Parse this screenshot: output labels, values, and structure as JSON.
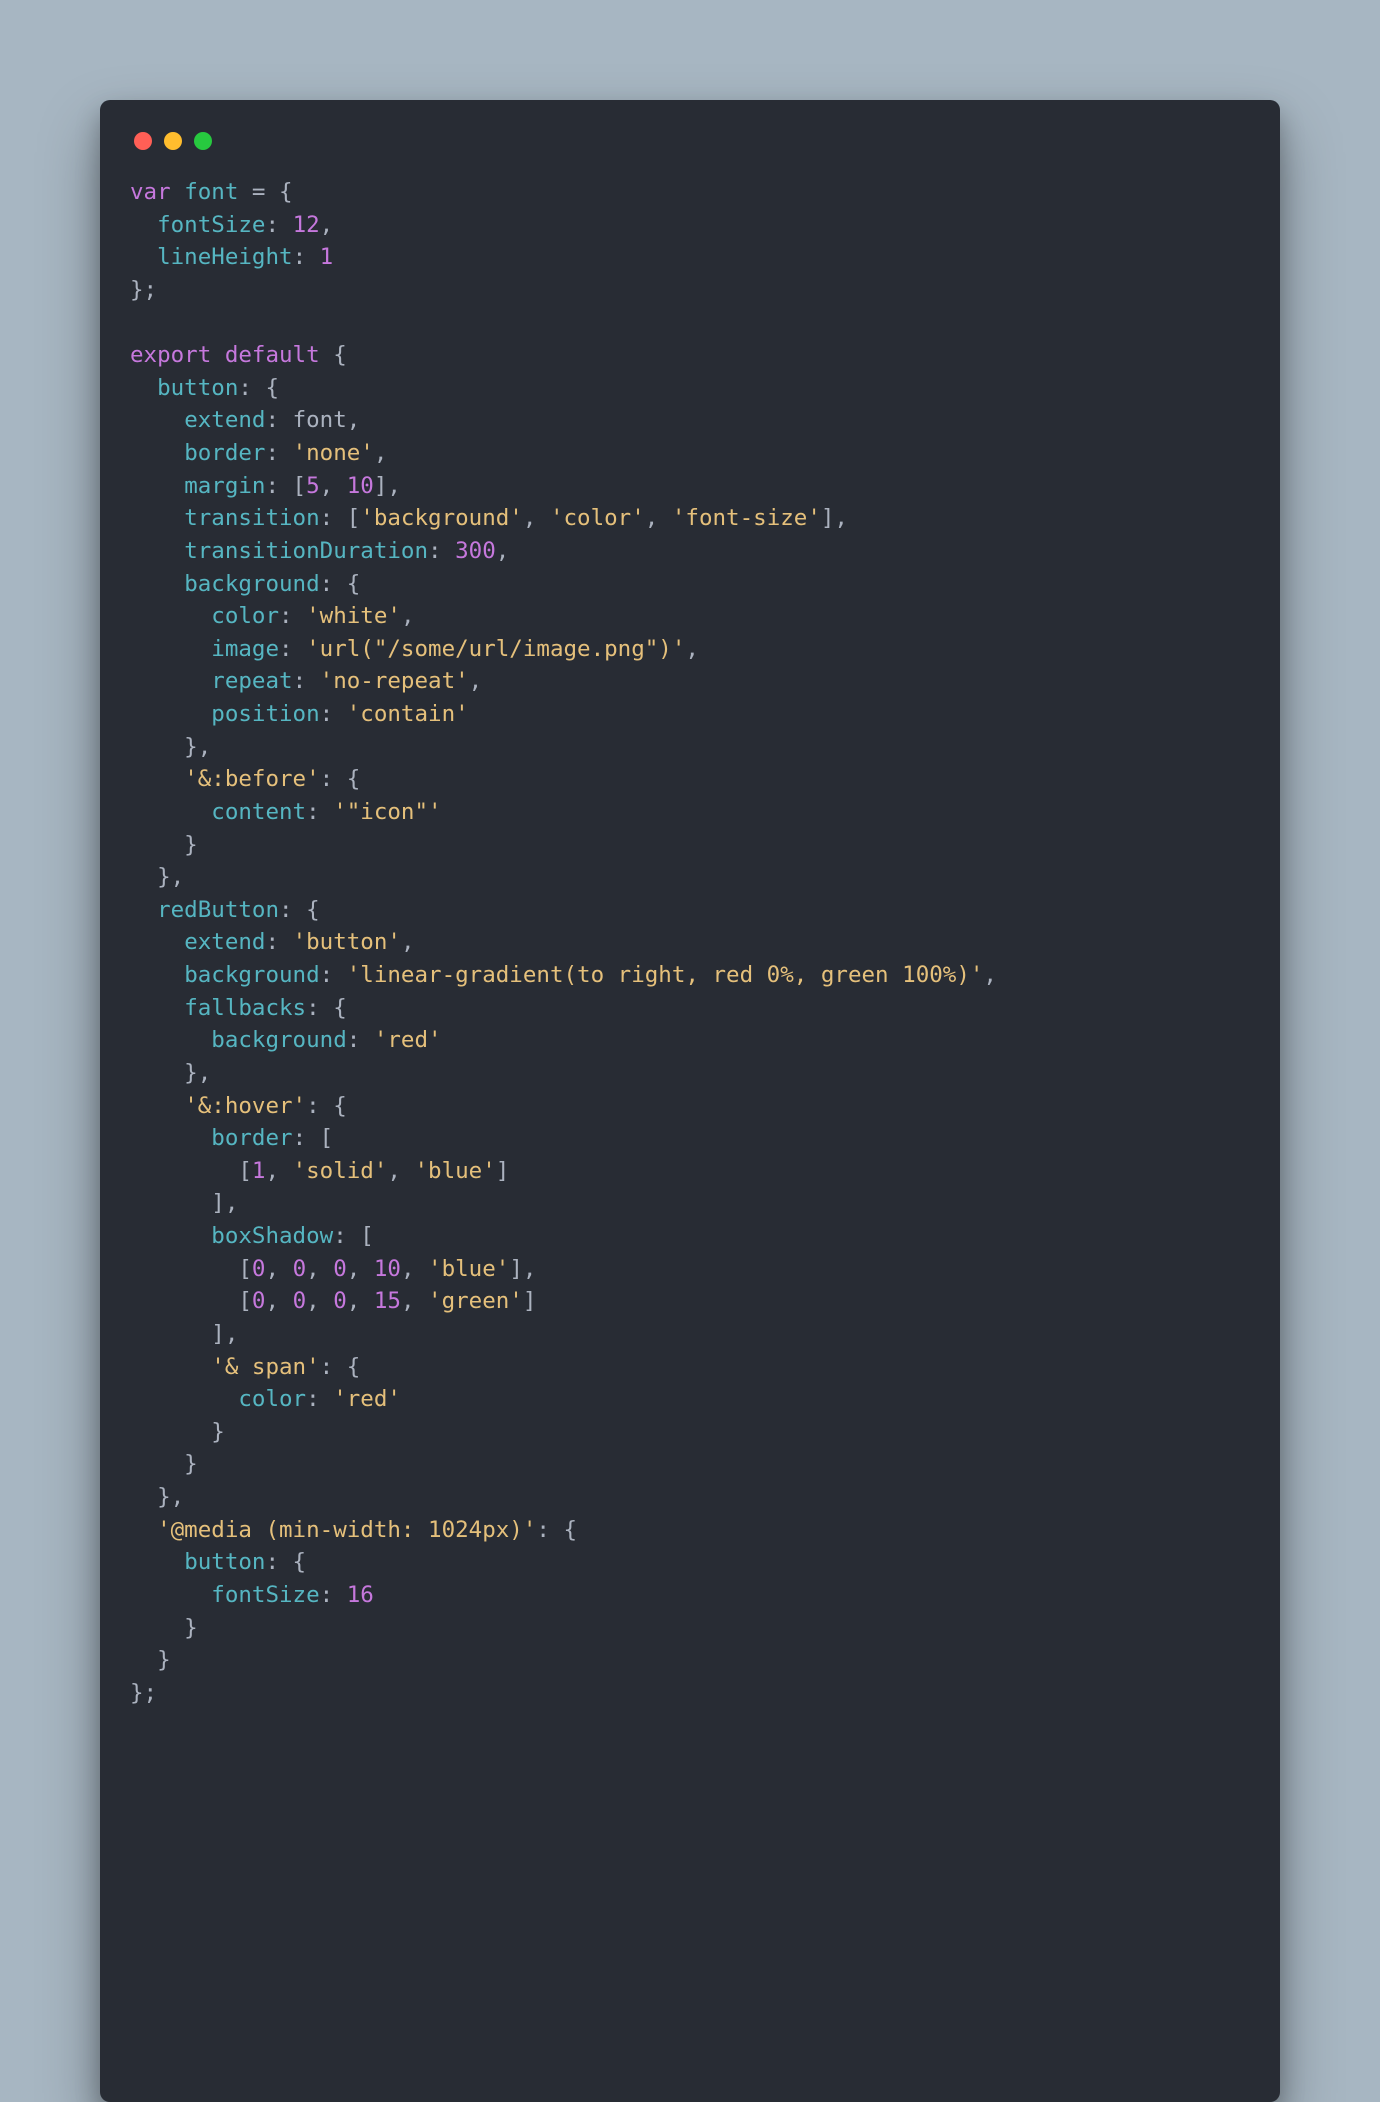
{
  "window": {
    "dots": [
      "red",
      "yellow",
      "green"
    ]
  },
  "tokens": [
    [
      [
        "kw",
        "var "
      ],
      [
        "pr",
        "font"
      ],
      [
        "pn",
        " = {"
      ]
    ],
    [
      [
        "pn",
        "  "
      ],
      [
        "pr",
        "fontSize"
      ],
      [
        "pn",
        ": "
      ],
      [
        "nu",
        "12"
      ],
      [
        "pn",
        ","
      ]
    ],
    [
      [
        "pn",
        "  "
      ],
      [
        "pr",
        "lineHeight"
      ],
      [
        "pn",
        ": "
      ],
      [
        "nu",
        "1"
      ]
    ],
    [
      [
        "pn",
        "};"
      ]
    ],
    [
      [
        "pn",
        ""
      ]
    ],
    [
      [
        "kw",
        "export default"
      ],
      [
        "pn",
        " {"
      ]
    ],
    [
      [
        "pn",
        "  "
      ],
      [
        "pr",
        "button"
      ],
      [
        "pn",
        ": {"
      ]
    ],
    [
      [
        "pn",
        "    "
      ],
      [
        "pr",
        "extend"
      ],
      [
        "pn",
        ": "
      ],
      [
        "df",
        "font"
      ],
      [
        "pn",
        ","
      ]
    ],
    [
      [
        "pn",
        "    "
      ],
      [
        "pr",
        "border"
      ],
      [
        "pn",
        ": "
      ],
      [
        "st",
        "'none'"
      ],
      [
        "pn",
        ","
      ]
    ],
    [
      [
        "pn",
        "    "
      ],
      [
        "pr",
        "margin"
      ],
      [
        "pn",
        ": ["
      ],
      [
        "nu",
        "5"
      ],
      [
        "pn",
        ", "
      ],
      [
        "nu",
        "10"
      ],
      [
        "pn",
        "],"
      ]
    ],
    [
      [
        "pn",
        "    "
      ],
      [
        "pr",
        "transition"
      ],
      [
        "pn",
        ": ["
      ],
      [
        "st",
        "'background'"
      ],
      [
        "pn",
        ", "
      ],
      [
        "st",
        "'color'"
      ],
      [
        "pn",
        ", "
      ],
      [
        "st",
        "'font-size'"
      ],
      [
        "pn",
        "],"
      ]
    ],
    [
      [
        "pn",
        "    "
      ],
      [
        "pr",
        "transitionDuration"
      ],
      [
        "pn",
        ": "
      ],
      [
        "nu",
        "300"
      ],
      [
        "pn",
        ","
      ]
    ],
    [
      [
        "pn",
        "    "
      ],
      [
        "pr",
        "background"
      ],
      [
        "pn",
        ": {"
      ]
    ],
    [
      [
        "pn",
        "      "
      ],
      [
        "pr",
        "color"
      ],
      [
        "pn",
        ": "
      ],
      [
        "st",
        "'white'"
      ],
      [
        "pn",
        ","
      ]
    ],
    [
      [
        "pn",
        "      "
      ],
      [
        "pr",
        "image"
      ],
      [
        "pn",
        ": "
      ],
      [
        "st",
        "'url(\"/some/url/image.png\")'"
      ],
      [
        "pn",
        ","
      ]
    ],
    [
      [
        "pn",
        "      "
      ],
      [
        "pr",
        "repeat"
      ],
      [
        "pn",
        ": "
      ],
      [
        "st",
        "'no-repeat'"
      ],
      [
        "pn",
        ","
      ]
    ],
    [
      [
        "pn",
        "      "
      ],
      [
        "pr",
        "position"
      ],
      [
        "pn",
        ": "
      ],
      [
        "st",
        "'contain'"
      ]
    ],
    [
      [
        "pn",
        "    },"
      ]
    ],
    [
      [
        "pn",
        "    "
      ],
      [
        "st",
        "'&:before'"
      ],
      [
        "pn",
        ": {"
      ]
    ],
    [
      [
        "pn",
        "      "
      ],
      [
        "pr",
        "content"
      ],
      [
        "pn",
        ": "
      ],
      [
        "st",
        "'\"icon\"'"
      ]
    ],
    [
      [
        "pn",
        "    }"
      ]
    ],
    [
      [
        "pn",
        "  },"
      ]
    ],
    [
      [
        "pn",
        "  "
      ],
      [
        "pr",
        "redButton"
      ],
      [
        "pn",
        ": {"
      ]
    ],
    [
      [
        "pn",
        "    "
      ],
      [
        "pr",
        "extend"
      ],
      [
        "pn",
        ": "
      ],
      [
        "st",
        "'button'"
      ],
      [
        "pn",
        ","
      ]
    ],
    [
      [
        "pn",
        "    "
      ],
      [
        "pr",
        "background"
      ],
      [
        "pn",
        ": "
      ],
      [
        "st",
        "'linear-gradient(to right, red 0%, green 100%)'"
      ],
      [
        "pn",
        ","
      ]
    ],
    [
      [
        "pn",
        "    "
      ],
      [
        "pr",
        "fallbacks"
      ],
      [
        "pn",
        ": {"
      ]
    ],
    [
      [
        "pn",
        "      "
      ],
      [
        "pr",
        "background"
      ],
      [
        "pn",
        ": "
      ],
      [
        "st",
        "'red'"
      ]
    ],
    [
      [
        "pn",
        "    },"
      ]
    ],
    [
      [
        "pn",
        "    "
      ],
      [
        "st",
        "'&:hover'"
      ],
      [
        "pn",
        ": {"
      ]
    ],
    [
      [
        "pn",
        "      "
      ],
      [
        "pr",
        "border"
      ],
      [
        "pn",
        ": ["
      ]
    ],
    [
      [
        "pn",
        "        ["
      ],
      [
        "nu",
        "1"
      ],
      [
        "pn",
        ", "
      ],
      [
        "st",
        "'solid'"
      ],
      [
        "pn",
        ", "
      ],
      [
        "st",
        "'blue'"
      ],
      [
        "pn",
        "]"
      ]
    ],
    [
      [
        "pn",
        "      ],"
      ]
    ],
    [
      [
        "pn",
        "      "
      ],
      [
        "pr",
        "boxShadow"
      ],
      [
        "pn",
        ": ["
      ]
    ],
    [
      [
        "pn",
        "        ["
      ],
      [
        "nu",
        "0"
      ],
      [
        "pn",
        ", "
      ],
      [
        "nu",
        "0"
      ],
      [
        "pn",
        ", "
      ],
      [
        "nu",
        "0"
      ],
      [
        "pn",
        ", "
      ],
      [
        "nu",
        "10"
      ],
      [
        "pn",
        ", "
      ],
      [
        "st",
        "'blue'"
      ],
      [
        "pn",
        "],"
      ]
    ],
    [
      [
        "pn",
        "        ["
      ],
      [
        "nu",
        "0"
      ],
      [
        "pn",
        ", "
      ],
      [
        "nu",
        "0"
      ],
      [
        "pn",
        ", "
      ],
      [
        "nu",
        "0"
      ],
      [
        "pn",
        ", "
      ],
      [
        "nu",
        "15"
      ],
      [
        "pn",
        ", "
      ],
      [
        "st",
        "'green'"
      ],
      [
        "pn",
        "]"
      ]
    ],
    [
      [
        "pn",
        "      ],"
      ]
    ],
    [
      [
        "pn",
        "      "
      ],
      [
        "st",
        "'& span'"
      ],
      [
        "pn",
        ": {"
      ]
    ],
    [
      [
        "pn",
        "        "
      ],
      [
        "pr",
        "color"
      ],
      [
        "pn",
        ": "
      ],
      [
        "st",
        "'red'"
      ]
    ],
    [
      [
        "pn",
        "      }"
      ]
    ],
    [
      [
        "pn",
        "    }"
      ]
    ],
    [
      [
        "pn",
        "  },"
      ]
    ],
    [
      [
        "pn",
        "  "
      ],
      [
        "st",
        "'@media (min-width: 1024px)'"
      ],
      [
        "pn",
        ": {"
      ]
    ],
    [
      [
        "pn",
        "    "
      ],
      [
        "pr",
        "button"
      ],
      [
        "pn",
        ": {"
      ]
    ],
    [
      [
        "pn",
        "      "
      ],
      [
        "pr",
        "fontSize"
      ],
      [
        "pn",
        ": "
      ],
      [
        "nu",
        "16"
      ]
    ],
    [
      [
        "pn",
        "    }"
      ]
    ],
    [
      [
        "pn",
        "  }"
      ]
    ],
    [
      [
        "pn",
        "};"
      ]
    ]
  ]
}
